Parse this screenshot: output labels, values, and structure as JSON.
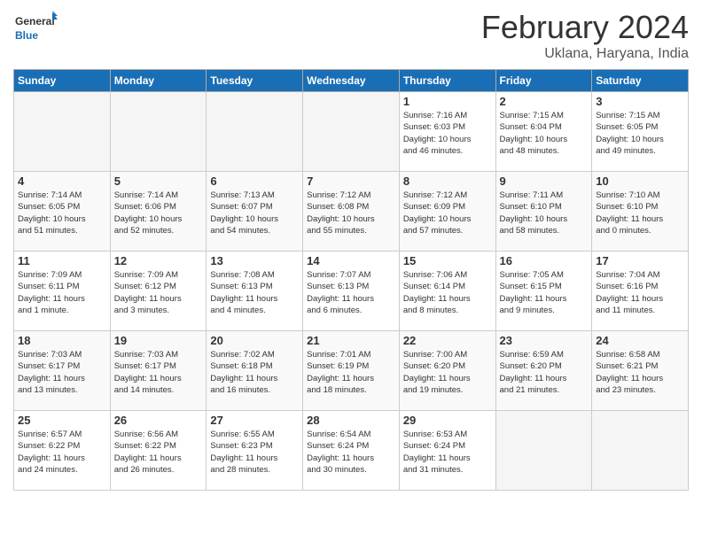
{
  "logo": {
    "text_general": "General",
    "text_blue": "Blue"
  },
  "header": {
    "month": "February 2024",
    "location": "Uklana, Haryana, India"
  },
  "weekdays": [
    "Sunday",
    "Monday",
    "Tuesday",
    "Wednesday",
    "Thursday",
    "Friday",
    "Saturday"
  ],
  "weeks": [
    [
      {
        "day": "",
        "info": ""
      },
      {
        "day": "",
        "info": ""
      },
      {
        "day": "",
        "info": ""
      },
      {
        "day": "",
        "info": ""
      },
      {
        "day": "1",
        "info": "Sunrise: 7:16 AM\nSunset: 6:03 PM\nDaylight: 10 hours\nand 46 minutes."
      },
      {
        "day": "2",
        "info": "Sunrise: 7:15 AM\nSunset: 6:04 PM\nDaylight: 10 hours\nand 48 minutes."
      },
      {
        "day": "3",
        "info": "Sunrise: 7:15 AM\nSunset: 6:05 PM\nDaylight: 10 hours\nand 49 minutes."
      }
    ],
    [
      {
        "day": "4",
        "info": "Sunrise: 7:14 AM\nSunset: 6:05 PM\nDaylight: 10 hours\nand 51 minutes."
      },
      {
        "day": "5",
        "info": "Sunrise: 7:14 AM\nSunset: 6:06 PM\nDaylight: 10 hours\nand 52 minutes."
      },
      {
        "day": "6",
        "info": "Sunrise: 7:13 AM\nSunset: 6:07 PM\nDaylight: 10 hours\nand 54 minutes."
      },
      {
        "day": "7",
        "info": "Sunrise: 7:12 AM\nSunset: 6:08 PM\nDaylight: 10 hours\nand 55 minutes."
      },
      {
        "day": "8",
        "info": "Sunrise: 7:12 AM\nSunset: 6:09 PM\nDaylight: 10 hours\nand 57 minutes."
      },
      {
        "day": "9",
        "info": "Sunrise: 7:11 AM\nSunset: 6:10 PM\nDaylight: 10 hours\nand 58 minutes."
      },
      {
        "day": "10",
        "info": "Sunrise: 7:10 AM\nSunset: 6:10 PM\nDaylight: 11 hours\nand 0 minutes."
      }
    ],
    [
      {
        "day": "11",
        "info": "Sunrise: 7:09 AM\nSunset: 6:11 PM\nDaylight: 11 hours\nand 1 minute."
      },
      {
        "day": "12",
        "info": "Sunrise: 7:09 AM\nSunset: 6:12 PM\nDaylight: 11 hours\nand 3 minutes."
      },
      {
        "day": "13",
        "info": "Sunrise: 7:08 AM\nSunset: 6:13 PM\nDaylight: 11 hours\nand 4 minutes."
      },
      {
        "day": "14",
        "info": "Sunrise: 7:07 AM\nSunset: 6:13 PM\nDaylight: 11 hours\nand 6 minutes."
      },
      {
        "day": "15",
        "info": "Sunrise: 7:06 AM\nSunset: 6:14 PM\nDaylight: 11 hours\nand 8 minutes."
      },
      {
        "day": "16",
        "info": "Sunrise: 7:05 AM\nSunset: 6:15 PM\nDaylight: 11 hours\nand 9 minutes."
      },
      {
        "day": "17",
        "info": "Sunrise: 7:04 AM\nSunset: 6:16 PM\nDaylight: 11 hours\nand 11 minutes."
      }
    ],
    [
      {
        "day": "18",
        "info": "Sunrise: 7:03 AM\nSunset: 6:17 PM\nDaylight: 11 hours\nand 13 minutes."
      },
      {
        "day": "19",
        "info": "Sunrise: 7:03 AM\nSunset: 6:17 PM\nDaylight: 11 hours\nand 14 minutes."
      },
      {
        "day": "20",
        "info": "Sunrise: 7:02 AM\nSunset: 6:18 PM\nDaylight: 11 hours\nand 16 minutes."
      },
      {
        "day": "21",
        "info": "Sunrise: 7:01 AM\nSunset: 6:19 PM\nDaylight: 11 hours\nand 18 minutes."
      },
      {
        "day": "22",
        "info": "Sunrise: 7:00 AM\nSunset: 6:20 PM\nDaylight: 11 hours\nand 19 minutes."
      },
      {
        "day": "23",
        "info": "Sunrise: 6:59 AM\nSunset: 6:20 PM\nDaylight: 11 hours\nand 21 minutes."
      },
      {
        "day": "24",
        "info": "Sunrise: 6:58 AM\nSunset: 6:21 PM\nDaylight: 11 hours\nand 23 minutes."
      }
    ],
    [
      {
        "day": "25",
        "info": "Sunrise: 6:57 AM\nSunset: 6:22 PM\nDaylight: 11 hours\nand 24 minutes."
      },
      {
        "day": "26",
        "info": "Sunrise: 6:56 AM\nSunset: 6:22 PM\nDaylight: 11 hours\nand 26 minutes."
      },
      {
        "day": "27",
        "info": "Sunrise: 6:55 AM\nSunset: 6:23 PM\nDaylight: 11 hours\nand 28 minutes."
      },
      {
        "day": "28",
        "info": "Sunrise: 6:54 AM\nSunset: 6:24 PM\nDaylight: 11 hours\nand 30 minutes."
      },
      {
        "day": "29",
        "info": "Sunrise: 6:53 AM\nSunset: 6:24 PM\nDaylight: 11 hours\nand 31 minutes."
      },
      {
        "day": "",
        "info": ""
      },
      {
        "day": "",
        "info": ""
      }
    ]
  ]
}
